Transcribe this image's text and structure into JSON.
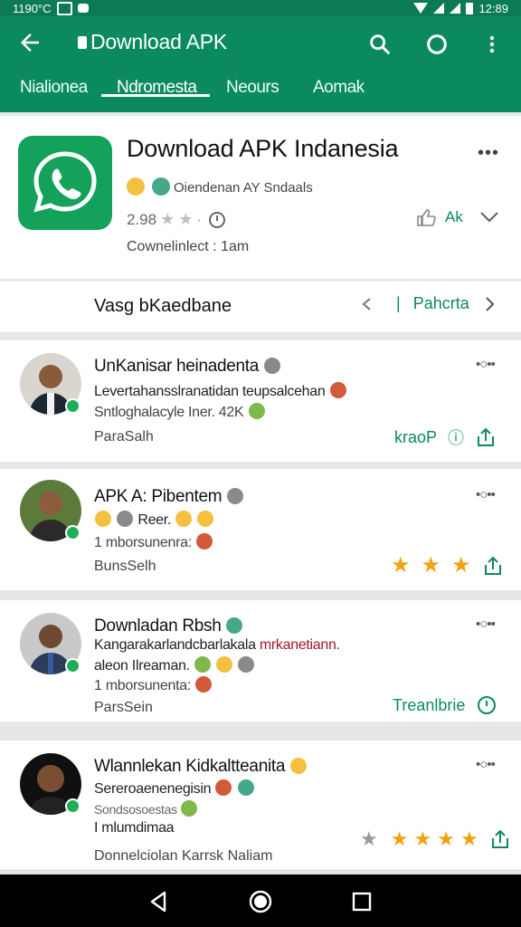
{
  "status_bar": {
    "time_left": "1190°C",
    "time_right": "12:89"
  },
  "appbar": {
    "title": "Download APK",
    "tabs": [
      "Nialionea",
      "Ndromesta",
      "Neours",
      "Aomak"
    ],
    "active_tab": 1
  },
  "app": {
    "title": "Download APK Indanesia",
    "developer": "Oiendenan AY Sndaals",
    "rating": "2.98",
    "share_label": "Ak",
    "downloaded": "Cownelinlect : 1am",
    "icon_color": "#14a15a"
  },
  "filter": {
    "label": "Vasg bKaedbane",
    "right_label": "Pahcrta"
  },
  "reviews": [
    {
      "name": "UnKanisar heinadenta",
      "line1": "Levertahansslranatidan teupsalcehan",
      "line2": "Sntloghalacyle Iner. 42K",
      "line3": "",
      "author": "ParaSalh",
      "action_label": "kraoP",
      "action_type": "text"
    },
    {
      "name": "APK A: Pibentem",
      "line1": "Reer.",
      "line2": "1 mborsunenra:",
      "line3": "",
      "author": "BunsSelh",
      "action_label": "",
      "action_type": "stars"
    },
    {
      "name": "Downladan Rbsh",
      "line1": "Kangarakarlandcbarlakala",
      "line1_red": "mrkanetiann.",
      "line2": "aleon Ilreaman.",
      "line3": "1 mborsunenta:",
      "author": "ParsSein",
      "action_label": "Treanlbrie",
      "action_type": "text"
    },
    {
      "name": "Wlannlekan Kidkaltteanita",
      "line1": "Sereroaenenegisin",
      "line2": "Sondsosoestas",
      "line3": "I mlumdimaa",
      "author": "Donnelciolan Karrsk Naliam",
      "action_label": "",
      "action_type": "stars"
    }
  ],
  "colors": {
    "primary": "#0b8a60",
    "star": "#f2a20f"
  }
}
